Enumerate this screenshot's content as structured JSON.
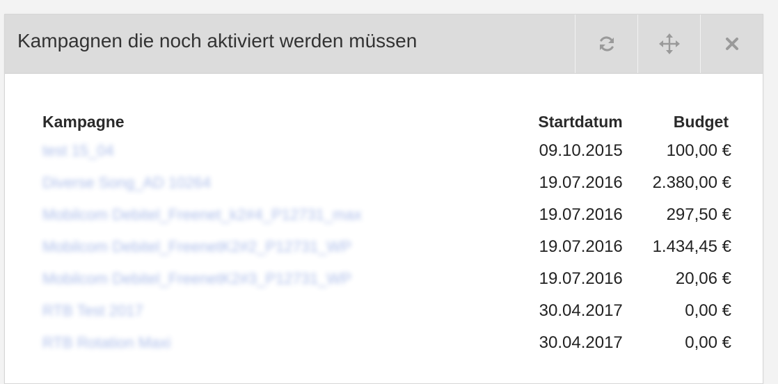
{
  "widget": {
    "title": "Kampagnen die noch aktiviert werden müssen",
    "buttons": {
      "refresh_icon": "refresh-icon",
      "move_icon": "move-icon",
      "close_icon": "close-icon"
    }
  },
  "table": {
    "headers": {
      "campaign": "Kampagne",
      "start_date": "Startdatum",
      "budget": "Budget"
    },
    "rows": [
      {
        "campaign": "test 15_04",
        "start_date": "09.10.2015",
        "budget": "100,00 €"
      },
      {
        "campaign": "Diverse Song_AD 10264",
        "start_date": "19.07.2016",
        "budget": "2.380,00 €"
      },
      {
        "campaign": "Mobilcom Debitel_Freenet_k2#4_P12731_max",
        "start_date": "19.07.2016",
        "budget": "297,50 €"
      },
      {
        "campaign": "Mobilcom Debitel_FreenetK2#2_P12731_WP",
        "start_date": "19.07.2016",
        "budget": "1.434,45 €"
      },
      {
        "campaign": "Mobilcom Debitel_FreenetK2#3_P12731_WP",
        "start_date": "19.07.2016",
        "budget": "20,06 €"
      },
      {
        "campaign": "RTB Test 2017",
        "start_date": "30.04.2017",
        "budget": "0,00 €"
      },
      {
        "campaign": "RTB Rotation Maxi",
        "start_date": "30.04.2017",
        "budget": "0,00 €"
      }
    ]
  },
  "colors": {
    "header_bg": "#dcdcdc",
    "icon_gray": "#9a9a9a",
    "link_blue": "#4a6fd0"
  }
}
